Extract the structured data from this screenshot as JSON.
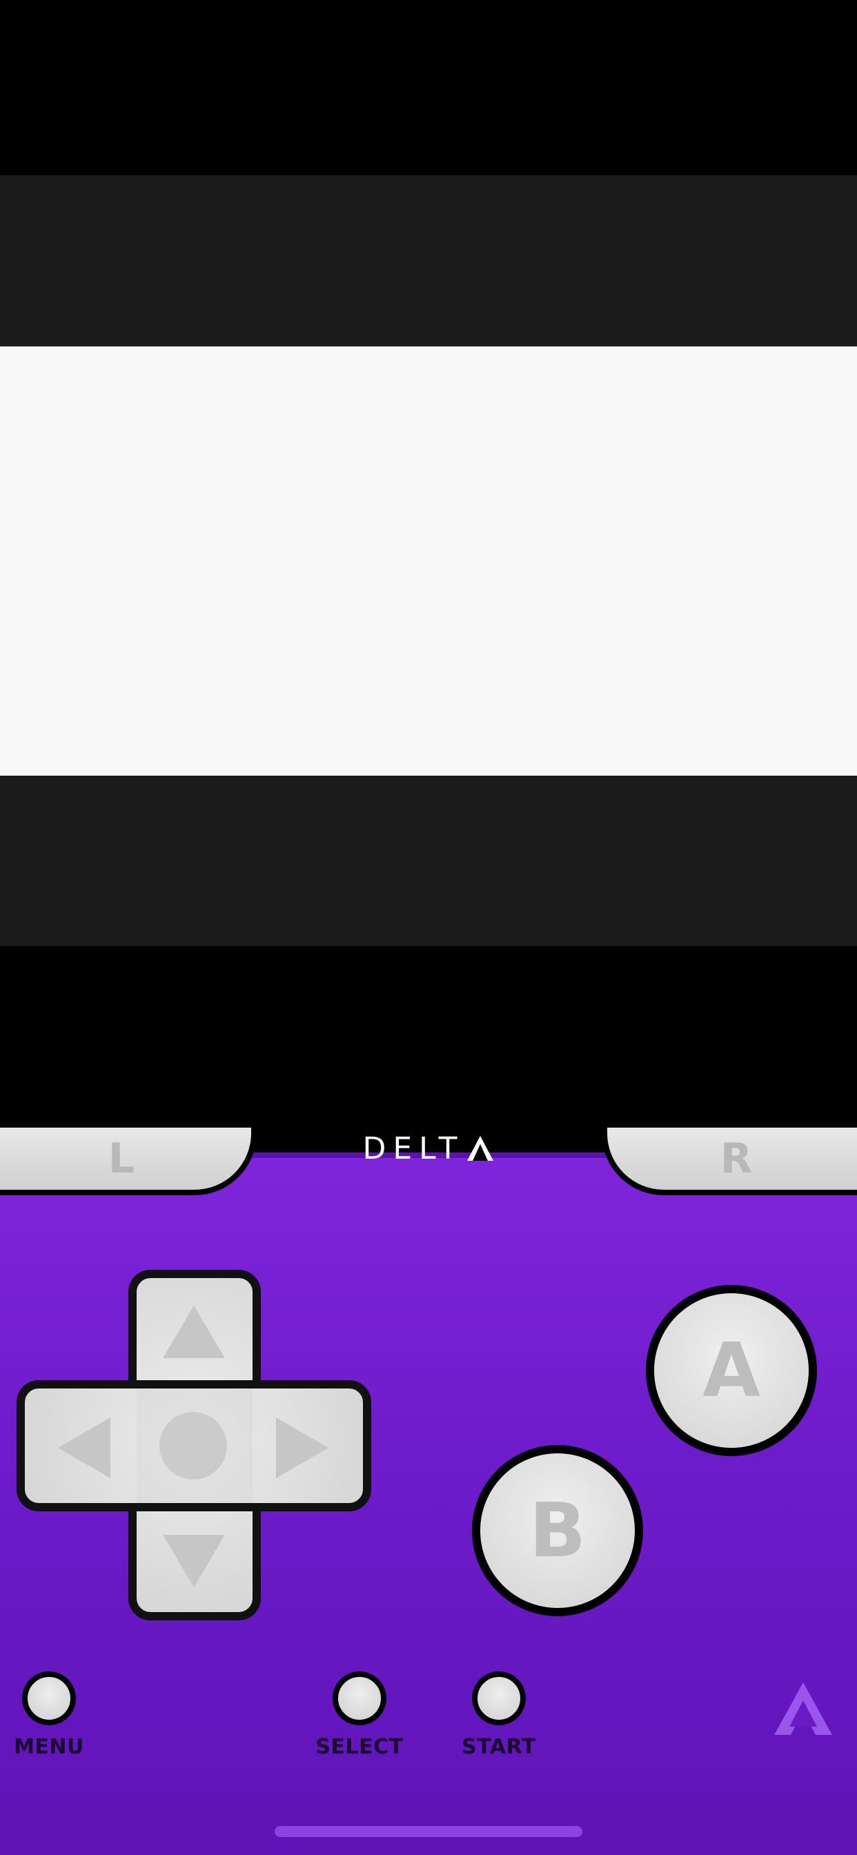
{
  "screen": {
    "bands": [
      "#000000",
      "#1b1b1b",
      "#f9f9f9",
      "#1b1b1b",
      "#000000"
    ]
  },
  "controller": {
    "logo_text": "DELT",
    "logo_icon": "delta-triangle-icon",
    "body_color": "#7f25db",
    "shoulder_left_label": "L",
    "shoulder_right_label": "R",
    "button_a_label": "A",
    "button_b_label": "B",
    "menu_label": "MENU",
    "select_label": "SELECT",
    "start_label": "START",
    "dpad_icons": [
      "dpad-up-icon",
      "dpad-down-icon",
      "dpad-left-icon",
      "dpad-right-icon"
    ],
    "corner_icon": "delta-logo-icon"
  }
}
